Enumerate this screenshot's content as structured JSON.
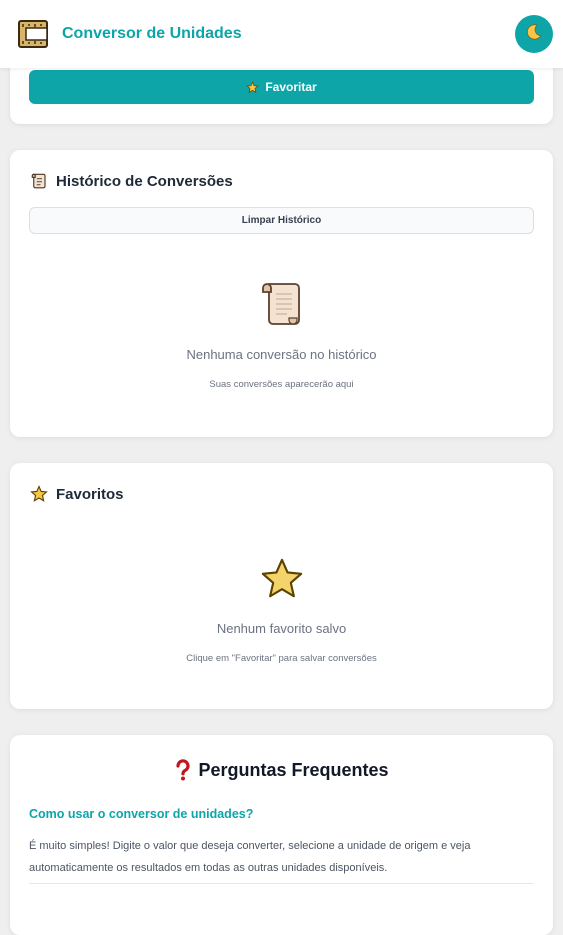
{
  "header": {
    "title": "Conversor de Unidades",
    "logo_icon": "ruler-icon",
    "theme_icon": "moon-icon"
  },
  "colors": {
    "accent": "#0ea5a8",
    "background": "#efefef",
    "card": "#ffffff"
  },
  "top_card": {
    "favorite_button_label": "Favoritar",
    "favorite_button_icon": "star-icon"
  },
  "history": {
    "title": "Histórico de Conversões",
    "title_icon": "scroll-icon",
    "clear_button_label": "Limpar Histórico",
    "empty_icon": "scroll-icon",
    "empty_title": "Nenhuma conversão no histórico",
    "empty_subtitle": "Suas conversões aparecerão aqui"
  },
  "favorites": {
    "title": "Favoritos",
    "title_icon": "star-icon",
    "empty_icon": "star-icon",
    "empty_title": "Nenhum favorito salvo",
    "empty_subtitle": "Clique em \"Favoritar\" para salvar conversões"
  },
  "faq": {
    "title": "Perguntas Frequentes",
    "title_icon": "question-mark-icon",
    "items": [
      {
        "question": "Como usar o conversor de unidades?",
        "answer": "É muito simples! Digite o valor que deseja converter, selecione a unidade de origem e veja automaticamente os resultados em todas as outras unidades disponíveis."
      }
    ]
  }
}
